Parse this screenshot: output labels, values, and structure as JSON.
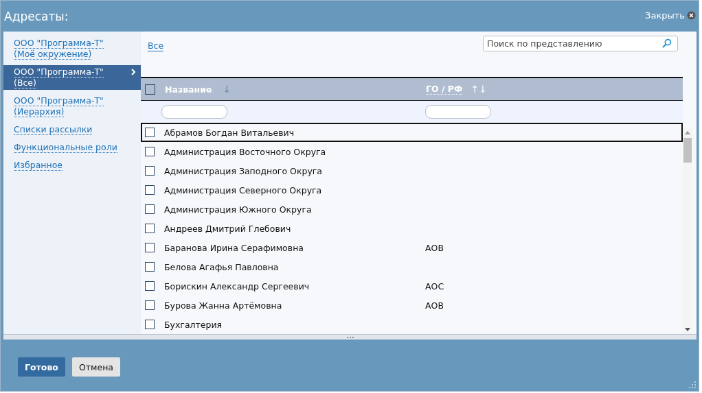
{
  "window": {
    "title": "Адресаты:",
    "close": "Закрыть"
  },
  "sidebar": {
    "items": [
      {
        "label": "ООО \"Программа-Т\" (Моё окружение)",
        "selected": false
      },
      {
        "label": "ООО \"Программа-Т\" (Все)",
        "selected": true
      },
      {
        "label": "ООО \"Программа-Т\" (Иерархия)",
        "selected": false
      },
      {
        "label": "Списки рассылки",
        "selected": false
      },
      {
        "label": "Функциональные роли",
        "selected": false
      },
      {
        "label": "Избранное",
        "selected": false
      }
    ]
  },
  "filter_link": "Все",
  "search": {
    "placeholder": "Поиск по представлению"
  },
  "table": {
    "select_all": {
      "checked": false
    },
    "columns": [
      {
        "label": "Название",
        "sort": "↓"
      },
      {
        "label": "ГО / РФ",
        "sort": "↑↓"
      }
    ],
    "rows": [
      {
        "name": "Абрамов Богдан Витальевич",
        "code": "",
        "checked": false,
        "focused": true
      },
      {
        "name": "Администрация Восточного Округа",
        "code": "",
        "checked": false,
        "focused": false
      },
      {
        "name": "Администрация Заподного Округа",
        "code": "",
        "checked": false,
        "focused": false
      },
      {
        "name": "Администрация Северного Округа",
        "code": "",
        "checked": false,
        "focused": false
      },
      {
        "name": "Администрация Южного Округа",
        "code": "",
        "checked": false,
        "focused": false
      },
      {
        "name": "Андреев Дмитрий Глебович",
        "code": "",
        "checked": false,
        "focused": false
      },
      {
        "name": "Баранова Ирина Серафимовна",
        "code": "АОВ",
        "checked": false,
        "focused": false
      },
      {
        "name": "Белова Агафья Павловна",
        "code": "",
        "checked": false,
        "focused": false
      },
      {
        "name": "Борискин Александр Сергеевич",
        "code": "АОС",
        "checked": false,
        "focused": false
      },
      {
        "name": "Бурова Жанна Артёмовна",
        "code": "АОВ",
        "checked": false,
        "focused": false
      },
      {
        "name": "Бухгалтерия",
        "code": "",
        "checked": false,
        "focused": false
      }
    ]
  },
  "buttons": [
    {
      "label": "Готово",
      "kind": "primary"
    },
    {
      "label": "Отмена",
      "kind": "secondary"
    }
  ]
}
